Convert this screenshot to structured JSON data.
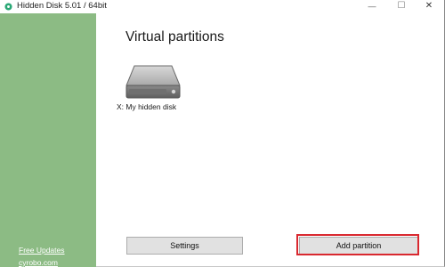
{
  "window": {
    "title": "Hidden Disk 5.01 / 64bit",
    "minimize_glyph": "—",
    "maximize_glyph": "☐",
    "close_glyph": "✕",
    "accent_color": "#2aa876"
  },
  "sidebar": {
    "background": "#8cbb84",
    "links": {
      "updates": "Free Updates",
      "site": "cyrobo.com"
    }
  },
  "main": {
    "heading": "Virtual partitions",
    "disks": [
      {
        "label": "X: My hidden disk",
        "icon": "hard-drive-icon"
      }
    ]
  },
  "footer": {
    "settings_label": "Settings",
    "add_partition_label": "Add partition",
    "highlight_color": "#d9282f"
  }
}
